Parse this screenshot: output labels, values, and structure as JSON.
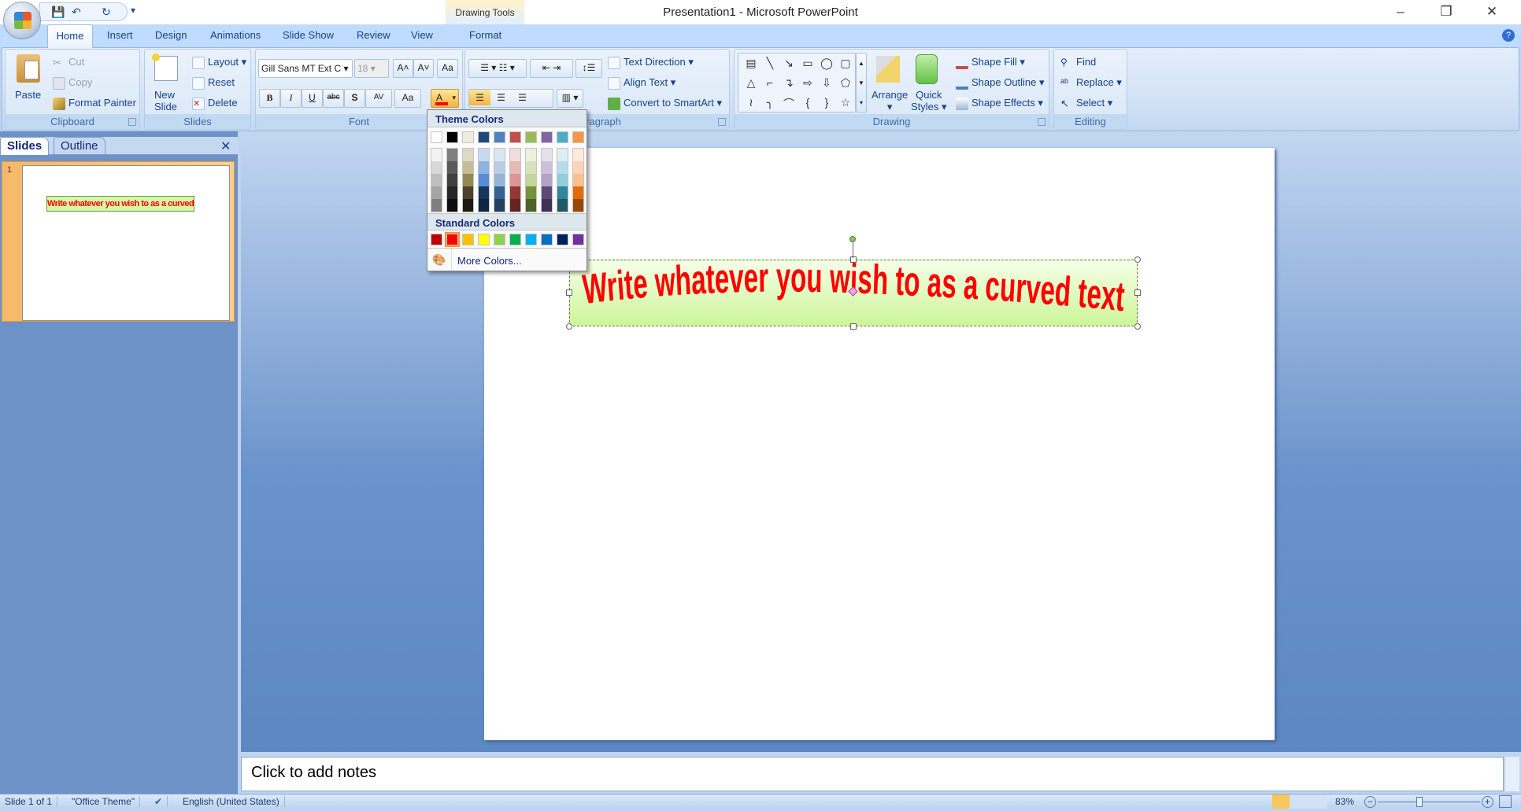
{
  "window": {
    "title": "Presentation1 - Microsoft PowerPoint",
    "minimize": "–",
    "restore": "❐",
    "close": "✕"
  },
  "qat": {
    "save": "💾",
    "undo": "↶",
    "redo": "↻",
    "more": "▾"
  },
  "contextual": {
    "header": "Drawing Tools",
    "tab": "Format"
  },
  "tabs": [
    "Home",
    "Insert",
    "Design",
    "Animations",
    "Slide Show",
    "Review",
    "View"
  ],
  "help": "?",
  "ribbon": {
    "clipboard": {
      "label": "Clipboard",
      "paste": "Paste",
      "cut": "Cut",
      "copy": "Copy",
      "format_painter": "Format Painter"
    },
    "slides": {
      "label": "Slides",
      "new_slide_1": "New",
      "new_slide_2": "Slide",
      "layout": "Layout",
      "reset": "Reset",
      "delete": "Delete"
    },
    "font": {
      "label": "Font",
      "font_name": "Gill Sans MT Ext C",
      "font_size": "18",
      "grow": "A˄",
      "shrink": "A˅",
      "clear": "Aa",
      "bold": "B",
      "italic": "I",
      "underline": "U",
      "strike": "abc",
      "shadow": "S",
      "spacing": "AV",
      "case": "Aa",
      "color": "A",
      "font_color": "#ff0000"
    },
    "paragraph": {
      "label": "Paragraph",
      "text_direction": "Text Direction",
      "align_text": "Align Text",
      "smartart": "Convert to SmartArt"
    },
    "drawing": {
      "label": "Drawing",
      "shapes": [
        "▤",
        "╲",
        "↘",
        "▭",
        "◯",
        "▢",
        "△",
        "⌐",
        "↴",
        "⇨",
        "⇩",
        "⬠",
        "≀",
        "╮",
        "⌒",
        "{",
        "}",
        "☆"
      ],
      "arrange": "Arrange",
      "quick_styles_1": "Quick",
      "quick_styles_2": "Styles",
      "shape_fill": "Shape Fill",
      "shape_outline": "Shape Outline",
      "shape_effects": "Shape Effects"
    },
    "editing": {
      "label": "Editing",
      "find": "Find",
      "replace": "Replace",
      "select": "Select"
    }
  },
  "font_color_menu": {
    "theme_header": "Theme Colors",
    "theme": [
      "#ffffff",
      "#000000",
      "#eeece1",
      "#1f497d",
      "#4f81bd",
      "#c0504d",
      "#9bbb59",
      "#8064a2",
      "#4bacc6",
      "#f79646"
    ],
    "shades": [
      [
        "#f2f2f2",
        "#d8d8d8",
        "#bfbfbf",
        "#a5a5a5",
        "#7f7f7f"
      ],
      [
        "#7f7f7f",
        "#595959",
        "#3f3f3f",
        "#262626",
        "#0c0c0c"
      ],
      [
        "#ddd9c3",
        "#c4bd97",
        "#938953",
        "#494429",
        "#1d1b10"
      ],
      [
        "#c6d9f0",
        "#8db3e2",
        "#548dd4",
        "#17365d",
        "#0f243e"
      ],
      [
        "#dbe5f1",
        "#b8cce4",
        "#95b3d7",
        "#366092",
        "#244061"
      ],
      [
        "#f2dcdb",
        "#e5b9b7",
        "#d99694",
        "#953734",
        "#632423"
      ],
      [
        "#ebf1dd",
        "#d7e3bc",
        "#c3d69b",
        "#76923c",
        "#4f6128"
      ],
      [
        "#e5e0ec",
        "#ccc1d9",
        "#b2a2c7",
        "#5f497a",
        "#3f3151"
      ],
      [
        "#dbeef3",
        "#b7dde8",
        "#92cddc",
        "#31859b",
        "#205867"
      ],
      [
        "#fdeada",
        "#fbd5b5",
        "#fac08f",
        "#e36c09",
        "#974806"
      ]
    ],
    "standard_header": "Standard Colors",
    "standard": [
      "#c00000",
      "#ff0000",
      "#ffc000",
      "#ffff00",
      "#92d050",
      "#00b050",
      "#00b0f0",
      "#0070c0",
      "#002060",
      "#7030a0"
    ],
    "selected": "#ff0000",
    "more": "More Colors..."
  },
  "left_pane": {
    "tabs": [
      "Slides",
      "Outline"
    ],
    "close": "✕",
    "slide_number": "1"
  },
  "slide": {
    "text": "Write whatever you wish to as a curved text",
    "text_color": "#ff0000"
  },
  "notes": {
    "placeholder": "Click to add notes"
  },
  "status": {
    "slide": "Slide 1 of 1",
    "theme": "\"Office Theme\"",
    "language": "English (United States)",
    "zoom": "83%",
    "zoom_percent": 83
  }
}
